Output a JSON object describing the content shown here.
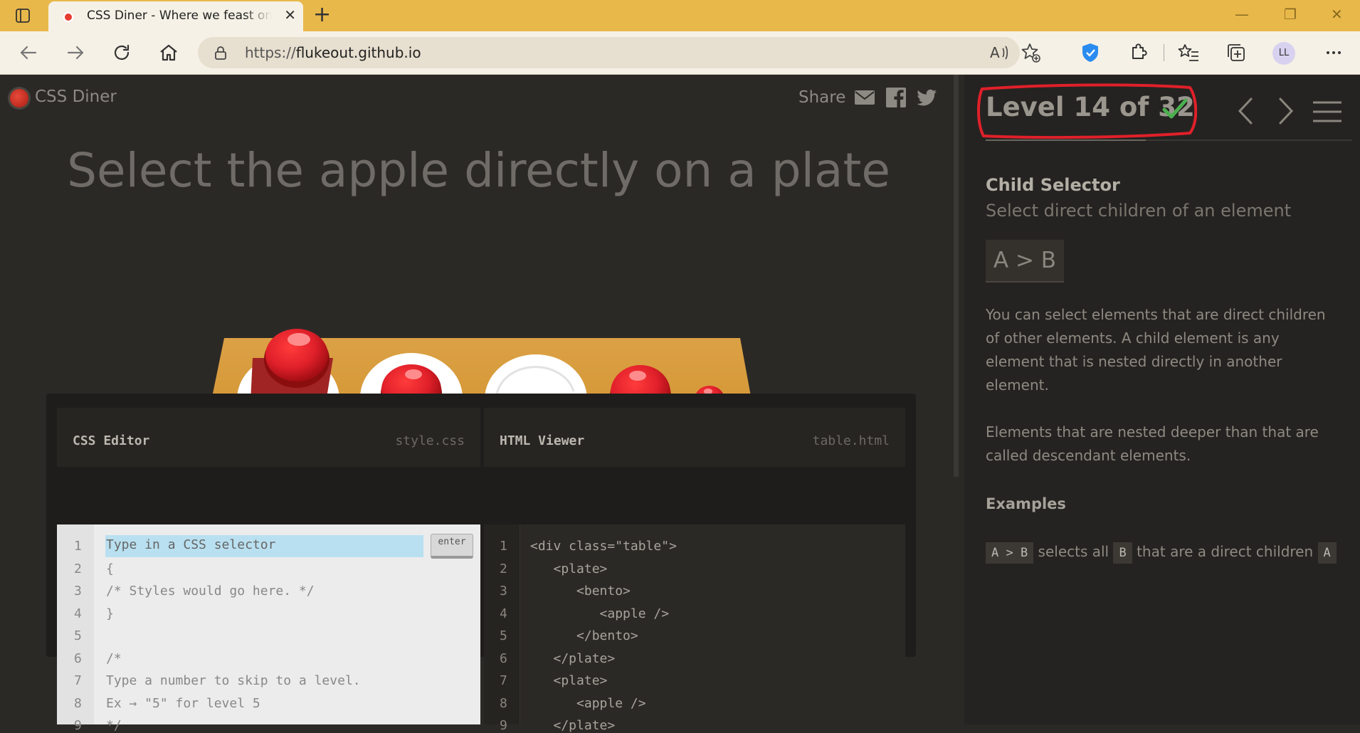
{
  "browser": {
    "tab_title": "CSS Diner - Where we feast on CSS Selectors!",
    "address_prefix": "https://",
    "address_domain": "flukeout.github.io",
    "profile_initials": "LL"
  },
  "game": {
    "logo": "CSS Diner",
    "share_label": "Share",
    "instructions": "Select the apple directly on a plate"
  },
  "css_editor": {
    "title": "CSS Editor",
    "filename": "style.css",
    "input_placeholder": "Type in a CSS selector",
    "enter_label": "enter",
    "line_numbers": [
      "1",
      "2",
      "3",
      "4",
      "5",
      "6",
      "7",
      "8",
      "9"
    ],
    "lines": [
      "{",
      "/* Styles would go here. */",
      "}",
      "",
      "/*",
      "Type a number to skip to a level.",
      "Ex → \"5\" for level 5",
      "*/"
    ]
  },
  "html_viewer": {
    "title": "HTML Viewer",
    "filename": "table.html",
    "line_numbers": [
      "1",
      "2",
      "3",
      "4",
      "5",
      "6",
      "7",
      "8",
      "9"
    ],
    "lines": [
      "<div class=\"table\">",
      "   <plate>",
      "      <bento>",
      "         <apple />",
      "      </bento>",
      "   </plate>",
      "   <plate>",
      "      <apple />",
      "   </plate>"
    ]
  },
  "sidebar": {
    "level_heading": "Level 14 of 32",
    "level_progress": 0.4375,
    "selector_name": "Child Selector",
    "selector_title": "Select direct children of an element",
    "syntax": "A > B",
    "hint_p1": "You can select elements that are direct children of other elements. A child element is any element that is nested directly in another element.",
    "hint_p2": "Elements that are nested deeper than that are called descendant elements.",
    "examples_title": "Examples",
    "example_tag1": "A > B",
    "example_text1": "selects all",
    "example_tag2": "B",
    "example_text2": "that are a direct children",
    "example_tag3": "A"
  },
  "colors": {
    "annotation_circle": "#e0202a",
    "checkmark": "#4caf50",
    "table_top": "#e09a2e",
    "apple": "#e0202a"
  }
}
